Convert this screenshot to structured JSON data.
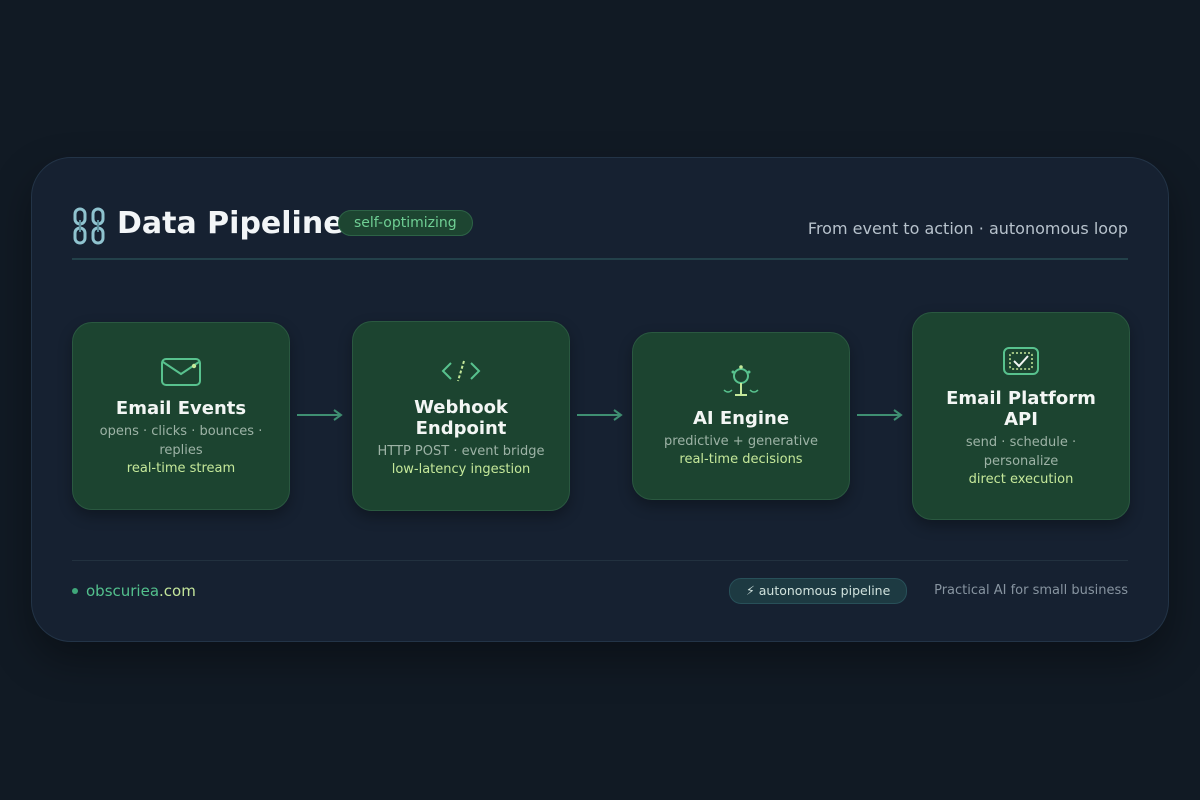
{
  "header": {
    "title": "Data Pipeline",
    "badge": "self-optimizing",
    "subtitle": "From event to action · autonomous loop"
  },
  "nodes": [
    {
      "icon": "envelope-icon",
      "title": "Email Events",
      "desc_lines": [
        "opens · clicks · bounces ·",
        "replies"
      ],
      "tag": "real-time stream"
    },
    {
      "icon": "code-icon",
      "title_lines": [
        "Webhook",
        "Endpoint"
      ],
      "desc_lines": [
        "HTTP POST · event bridge"
      ],
      "tag": "low-latency ingestion"
    },
    {
      "icon": "ai-engine-icon",
      "title": "AI Engine",
      "desc_lines": [
        "predictive + generative"
      ],
      "tag": "real-time decisions"
    },
    {
      "icon": "api-check-icon",
      "title_lines": [
        "Email Platform",
        "API"
      ],
      "desc_lines": [
        "send · schedule ·",
        "personalize"
      ],
      "tag": "direct execution"
    }
  ],
  "footer": {
    "brand_name": "obscuriea",
    "brand_tld": ".com",
    "pill": "⚡ autonomous pipeline",
    "tagline": "Practical AI for small business"
  },
  "colors": {
    "background": "#111a24",
    "card": "#162131",
    "node": "#1c4430",
    "accent": "#53c08d",
    "highlight": "#c5e89a"
  }
}
